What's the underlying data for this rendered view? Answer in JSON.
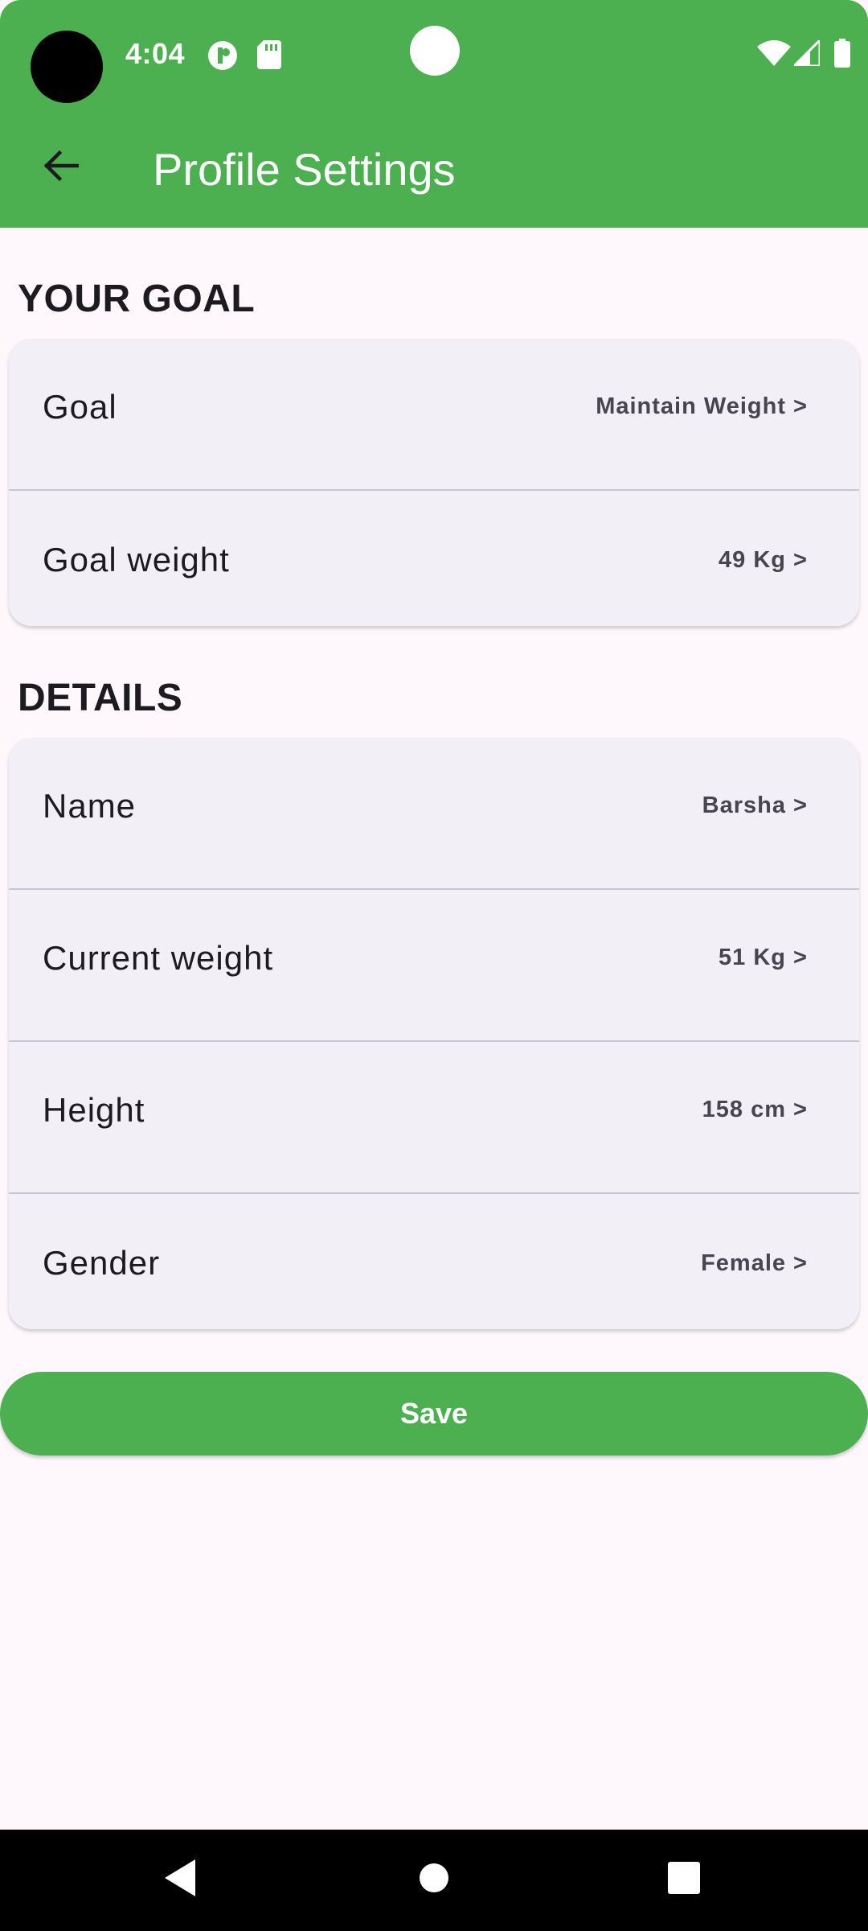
{
  "status_bar": {
    "time": "4:04",
    "icons": [
      "app-notification-icon",
      "sd-card-icon",
      "wifi-icon",
      "cellular-signal-icon",
      "battery-icon"
    ]
  },
  "app_bar": {
    "title": "Profile Settings",
    "back_icon": "arrow-back-icon"
  },
  "goal_section": {
    "heading": "YOUR GOAL",
    "rows": [
      {
        "label": "Goal",
        "value": "Maintain Weight >"
      },
      {
        "label": "Goal weight",
        "value": "49 Kg >"
      }
    ]
  },
  "details_section": {
    "heading": "DETAILS",
    "rows": [
      {
        "label": "Name",
        "value": "Barsha >"
      },
      {
        "label": "Current weight",
        "value": "51 Kg >"
      },
      {
        "label": "Height",
        "value": "158 cm >"
      },
      {
        "label": "Gender",
        "value": "Female >"
      }
    ]
  },
  "save_button": {
    "label": "Save"
  },
  "nav_bar": {
    "icons": [
      "nav-back-icon",
      "nav-home-icon",
      "nav-recents-icon"
    ]
  },
  "colors": {
    "accent": "#4caf50",
    "background": "#fef8fc",
    "card": "#f3eff7"
  }
}
